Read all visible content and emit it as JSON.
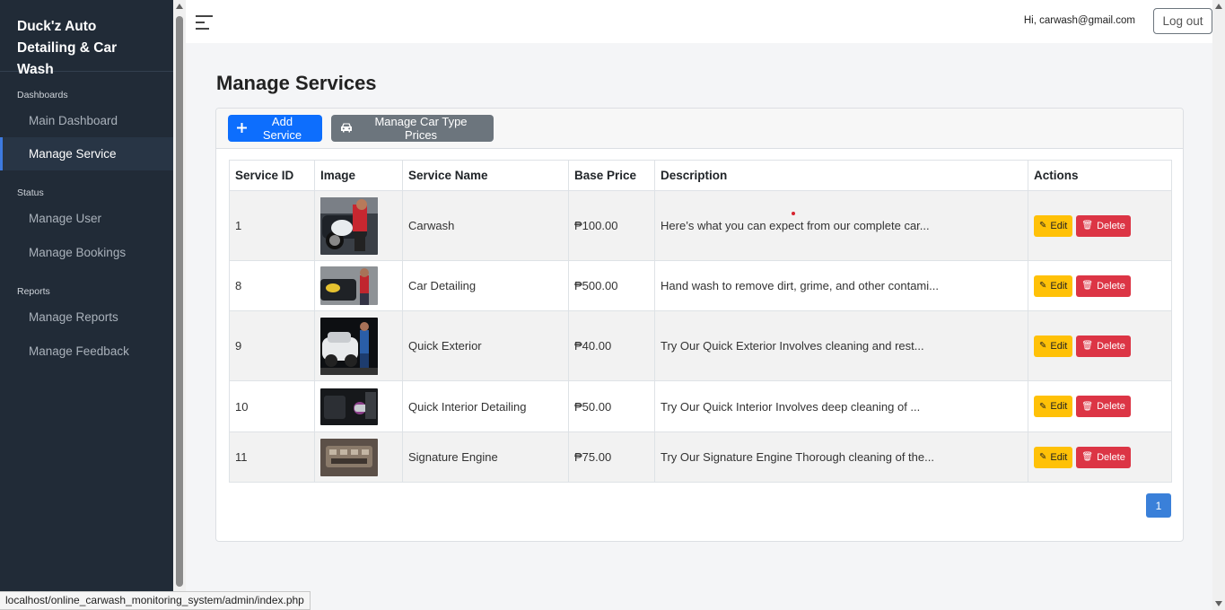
{
  "sidebar": {
    "brand": "Duck'z Auto Detailing & Car Wash",
    "sections": [
      {
        "title": "Dashboards",
        "items": [
          {
            "label": "Main Dashboard",
            "active": false
          },
          {
            "label": "Manage Service",
            "active": true
          }
        ]
      },
      {
        "title": "Status",
        "items": [
          {
            "label": "Manage User",
            "active": false
          },
          {
            "label": "Manage Bookings",
            "active": false
          }
        ]
      },
      {
        "title": "Reports",
        "items": [
          {
            "label": "Manage Reports",
            "active": false
          },
          {
            "label": "Manage Feedback",
            "active": false
          }
        ]
      }
    ]
  },
  "topbar": {
    "user_greeting": "Hi, carwash@gmail.com",
    "logout_label": "Log out"
  },
  "main": {
    "page_title": "Manage Services",
    "add_service_label": "Add Service",
    "car_type_prices_label": "Manage Car Type Prices",
    "table": {
      "headers": [
        "Service ID",
        "Image",
        "Service Name",
        "Base Price",
        "Description",
        "Actions"
      ],
      "rows": [
        {
          "id": "1",
          "name": "Carwash",
          "price": "₱100.00",
          "description": "Here’s what you can expect from our complete car...",
          "image": "carwash-photo"
        },
        {
          "id": "8",
          "name": "Car Detailing",
          "price": "₱500.00",
          "description": "Hand wash to remove dirt, grime, and other contami...",
          "image": "detailing-photo"
        },
        {
          "id": "9",
          "name": "Quick Exterior",
          "price": "₱40.00",
          "description": "Try Our Quick Exterior Involves cleaning and rest...",
          "image": "exterior-photo"
        },
        {
          "id": "10",
          "name": "Quick Interior Detailing",
          "price": "₱50.00",
          "description": "Try Our Quick Interior Involves deep cleaning of ...",
          "image": "interior-photo"
        },
        {
          "id": "11",
          "name": "Signature Engine",
          "price": "₱75.00",
          "description": "Try Our Signature Engine Thorough cleaning of the...",
          "image": "engine-photo"
        }
      ],
      "edit_label": "Edit",
      "delete_label": "Delete"
    },
    "pagination": {
      "current_page": "1"
    }
  },
  "statusbar": {
    "url": "localhost/online_carwash_monitoring_system/admin/index.php"
  },
  "colors": {
    "sidebar_bg": "#212b37",
    "primary": "#0d6efd",
    "secondary": "#6c757d",
    "warning": "#ffc107",
    "danger": "#dc3545",
    "active_accent": "#3d7ae0"
  }
}
